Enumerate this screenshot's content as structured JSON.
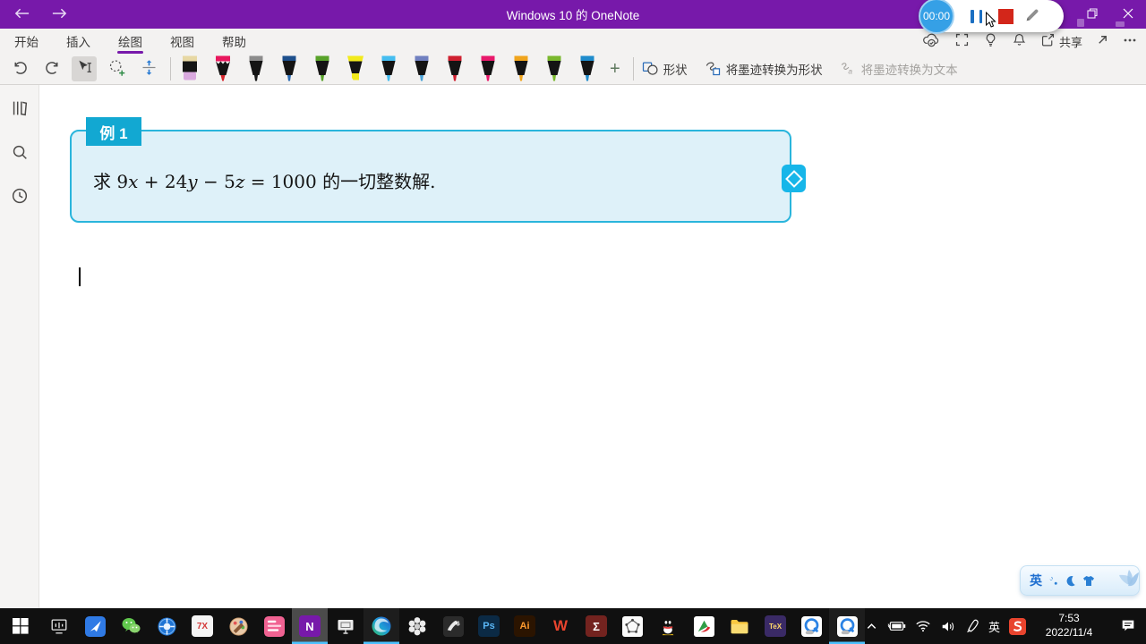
{
  "colors": {
    "accent": "#7719aa",
    "box_border": "#2ab5dc",
    "box_fill": "#def1f9",
    "badge_bg": "#12a8d2",
    "handle_bg": "#17b6e9",
    "timer_bg": "#35a0e6",
    "stop_red": "#d3261a",
    "pause_blue": "#1b6fc2",
    "taskbar_bg": "#101010"
  },
  "window": {
    "title": "Windows 10 的 OneNote"
  },
  "recorder": {
    "timer": "00:00"
  },
  "ribbon": {
    "tabs": [
      {
        "name": "home",
        "label": "开始"
      },
      {
        "name": "insert",
        "label": "插入"
      },
      {
        "name": "draw",
        "label": "绘图",
        "active": true
      },
      {
        "name": "view",
        "label": "视图"
      },
      {
        "name": "help",
        "label": "帮助"
      }
    ],
    "tools": [
      {
        "name": "undo",
        "icon": "undo"
      },
      {
        "name": "redo",
        "icon": "redo"
      },
      {
        "name": "select-objects",
        "icon": "selecttool",
        "active": true
      },
      {
        "name": "lasso-select",
        "icon": "lasso"
      },
      {
        "name": "insert-space",
        "icon": "space"
      }
    ],
    "pens": [
      {
        "name": "eraser",
        "type": "eraser"
      },
      {
        "name": "pencil",
        "type": "pencil",
        "band": "#e8175d",
        "tip": "#d7262c"
      },
      {
        "name": "black-pen",
        "type": "pen",
        "band": "#8c8c8c",
        "tip": "#1a1a1a"
      },
      {
        "name": "dark-blue-pen",
        "type": "pen",
        "band": "#1d4f8c",
        "tip": "#2e6db4"
      },
      {
        "name": "green-pen",
        "type": "pen",
        "band": "#58a32a",
        "tip": "#58a32a"
      },
      {
        "name": "yellow-highlighter",
        "type": "highlighter",
        "band": "#f2ea1c",
        "tip": "#f2ea1c"
      },
      {
        "name": "sky-blue-pen",
        "type": "pen",
        "band": "#45bdf0",
        "tip": "#45bdf0"
      },
      {
        "name": "galaxy-pen",
        "type": "pen",
        "band": "#7080c0",
        "tip": "#4aa3d8"
      },
      {
        "name": "red-pen",
        "type": "pen",
        "band": "#cf2030",
        "tip": "#cf2030"
      },
      {
        "name": "crimson-pen",
        "type": "pen",
        "band": "#e8196b",
        "tip": "#e8196b"
      },
      {
        "name": "amber-pen",
        "type": "pen",
        "band": "#f0a51d",
        "tip": "#f0a51d"
      },
      {
        "name": "lime-pen",
        "type": "pen",
        "band": "#7ab82e",
        "tip": "#7ab82e"
      },
      {
        "name": "azure-pen",
        "type": "pen",
        "band": "#1f8ccc",
        "tip": "#1f8ccc"
      }
    ],
    "add_pen_label": "+",
    "shape_buttons": [
      {
        "name": "shapes",
        "icon": "shapes",
        "label": "形状"
      },
      {
        "name": "ink-to-shape",
        "icon": "ink2shape",
        "label": "将墨迹转换为形状"
      },
      {
        "name": "ink-to-text",
        "icon": "ink2text",
        "label": "将墨迹转换为文本",
        "disabled": true
      }
    ],
    "right_actions": [
      {
        "name": "sync-status",
        "icon": "cloud"
      },
      {
        "name": "full-screen",
        "icon": "fullscr"
      },
      {
        "name": "tell-me",
        "icon": "bulb"
      },
      {
        "name": "notifications",
        "icon": "bell"
      },
      {
        "name": "share",
        "icon": "share",
        "label": "共享"
      },
      {
        "name": "pop-out",
        "icon": "diag"
      },
      {
        "name": "more-options",
        "icon": "dots"
      }
    ]
  },
  "sidebar": {
    "items": [
      {
        "name": "notebooks",
        "icon": "books"
      },
      {
        "name": "search",
        "icon": "searchm"
      },
      {
        "name": "recent-notes",
        "icon": "clockr"
      }
    ]
  },
  "page": {
    "example_label": "例 1",
    "equation_full": "求 9x + 24y − 5z = 1000 的一切整数解.",
    "equation_segments": [
      {
        "text": "求 "
      },
      {
        "text": "9"
      },
      {
        "text": "x",
        "italic": true
      },
      {
        "text": " + 24"
      },
      {
        "text": "y",
        "italic": true
      },
      {
        "text": " − 5"
      },
      {
        "text": "z",
        "italic": true
      },
      {
        "text": " = 1000 "
      },
      {
        "text": "的一切整数解."
      }
    ]
  },
  "ime_bar": {
    "mode": "英"
  },
  "taskbar": {
    "apps": [
      {
        "name": "start",
        "kind": "icon",
        "icon": "win"
      },
      {
        "name": "task-view",
        "kind": "icon",
        "icon": "taskview"
      },
      {
        "name": "app-feather",
        "kind": "icon",
        "icon": "feather"
      },
      {
        "name": "wechat",
        "kind": "icon",
        "icon": "wechat"
      },
      {
        "name": "app-shutter",
        "kind": "icon",
        "icon": "shutter"
      },
      {
        "name": "app-7x",
        "kind": "glyph",
        "text": "7X",
        "bg": "#f5f5f5",
        "fg": "#d43a3a",
        "size": 10
      },
      {
        "name": "paint",
        "kind": "icon",
        "icon": "palette"
      },
      {
        "name": "app-pink",
        "kind": "icon",
        "icon": "pinkapp"
      },
      {
        "name": "onenote",
        "kind": "glyph",
        "text": "N",
        "bg": "#7719aa",
        "fg": "#ffffff",
        "size": 13,
        "running": true,
        "focused": true
      },
      {
        "name": "screen-mirror",
        "kind": "icon",
        "icon": "screen"
      },
      {
        "name": "edge",
        "kind": "icon",
        "icon": "edge",
        "running": true
      },
      {
        "name": "app-flower",
        "kind": "icon",
        "icon": "flower"
      },
      {
        "name": "sketchpad-6",
        "kind": "icon",
        "icon": "hand6"
      },
      {
        "name": "photoshop",
        "kind": "glyph",
        "text": "Ps",
        "bg": "#0b2a45",
        "fg": "#5ab6f5",
        "size": 11
      },
      {
        "name": "illustrator",
        "kind": "glyph",
        "text": "Ai",
        "bg": "#2b1400",
        "fg": "#ff9a2e",
        "size": 11
      },
      {
        "name": "wps",
        "kind": "glyph",
        "text": "W",
        "bg": "transparent",
        "fg": "#e8442e",
        "size": 17
      },
      {
        "name": "app-sigma",
        "kind": "glyph",
        "text": "Σ",
        "bg": "#73231f",
        "fg": "#ffffff",
        "size": 13
      },
      {
        "name": "geometry",
        "kind": "icon",
        "icon": "geometry"
      },
      {
        "name": "qq",
        "kind": "icon",
        "icon": "qq"
      },
      {
        "name": "app-pdf",
        "kind": "icon",
        "icon": "pdfx"
      },
      {
        "name": "file-explorer",
        "kind": "icon",
        "icon": "folder"
      },
      {
        "name": "tex",
        "kind": "glyph",
        "text": "TeX",
        "bg": "#3a2a66",
        "fg": "#ffd86b",
        "size": 8
      },
      {
        "name": "q-browser-1",
        "kind": "icon",
        "icon": "qicon"
      },
      {
        "name": "q-browser-2",
        "kind": "icon",
        "icon": "qicon",
        "running": true
      }
    ],
    "tray": [
      {
        "name": "hidden-icons",
        "icon": "chevron"
      },
      {
        "name": "battery",
        "icon": "battery"
      },
      {
        "name": "network",
        "icon": "wifi"
      },
      {
        "name": "volume",
        "icon": "volume"
      },
      {
        "name": "pen-input",
        "icon": "stylus"
      },
      {
        "name": "ime-mode",
        "label": "英"
      },
      {
        "name": "sogou-ime",
        "icon": "sogou"
      }
    ],
    "clock": {
      "time": "7:53",
      "date": "2022/11/4"
    }
  }
}
